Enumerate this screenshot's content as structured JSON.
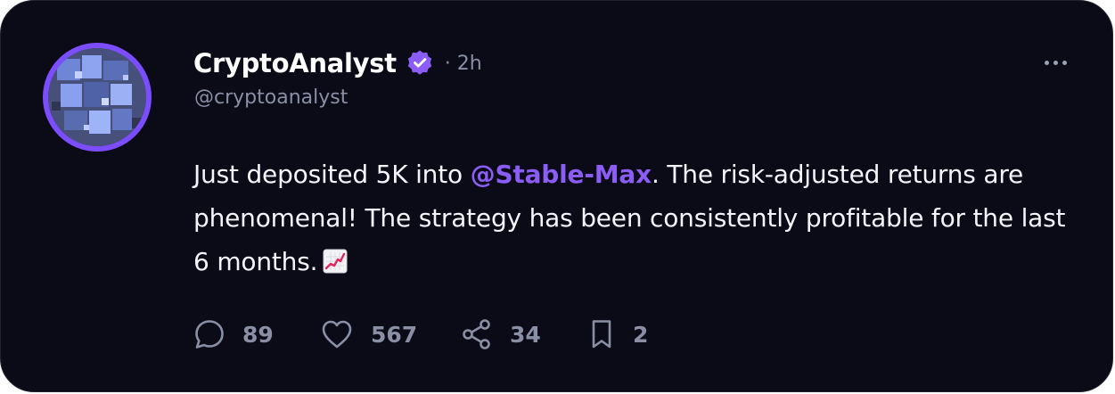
{
  "post": {
    "author": {
      "display_name": "CryptoAnalyst",
      "handle": "@cryptoanalyst",
      "verified": true,
      "verified_icon": "verified-badge-icon",
      "avatar": "avatar"
    },
    "time_label": "· 2h",
    "more_icon": "more-options-icon",
    "text": {
      "before_mention": "Just deposited 5K into ",
      "mention": "@Stable-Max",
      "after_mention": ". The risk-adjusted returns are phenomenal! The strategy has been consistently profitable for the last 6 months.",
      "emoji": "chart-increasing-emoji"
    },
    "stats": {
      "replies": "89",
      "likes": "567",
      "shares": "34",
      "bookmarks": "2"
    }
  },
  "colors": {
    "card_background": "#0a0b17",
    "accent": "#8b5cf6",
    "muted_text": "#8a8fa6",
    "primary_text": "#f4f5fa"
  }
}
